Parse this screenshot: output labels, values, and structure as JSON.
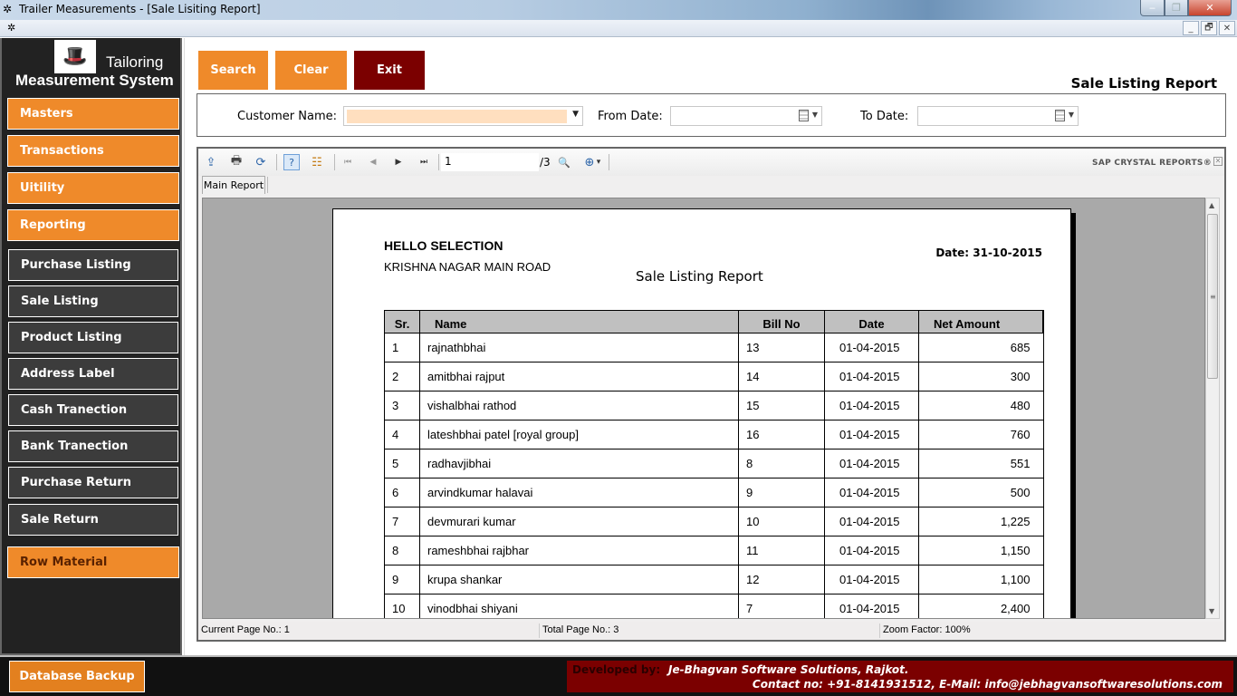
{
  "window": {
    "title": "Trailer Measurements - [Sale Lisiting Report]",
    "app_icon": "✲",
    "min": "‒",
    "max": "❐",
    "close": "✕"
  },
  "mdi": {
    "min": "_",
    "restore": "🗗",
    "close": "✕"
  },
  "sidebar": {
    "logo_line1": "Tailoring",
    "logo_line2": "Measurement System",
    "logo_icon": "🎩",
    "items": [
      {
        "label": "Masters",
        "style": "orange"
      },
      {
        "label": "Transactions",
        "style": "orange"
      },
      {
        "label": "Uitility",
        "style": "orange"
      },
      {
        "label": "Reporting",
        "style": "orange"
      },
      {
        "label": "Purchase Listing",
        "style": "dark"
      },
      {
        "label": "Sale Listing",
        "style": "dark"
      },
      {
        "label": "Product Listing",
        "style": "dark"
      },
      {
        "label": "Address Label",
        "style": "dark"
      },
      {
        "label": "Cash Tranection",
        "style": "dark"
      },
      {
        "label": "Bank Tranection",
        "style": "dark"
      },
      {
        "label": "Purchase Return",
        "style": "dark"
      },
      {
        "label": "Sale Return",
        "style": "dark"
      },
      {
        "label": "Row Material",
        "style": "orange"
      }
    ]
  },
  "toolbar": {
    "search": "Search",
    "clear": "Clear",
    "exit": "Exit"
  },
  "page_heading": "Sale Listing Report",
  "filters": {
    "customer_label": "Customer Name:",
    "customer_value": "",
    "from_label": "From Date:",
    "from_value": "",
    "to_label": "To Date:",
    "to_value": ""
  },
  "viewer": {
    "icons": {
      "export": "⇪",
      "print": "🖶",
      "refresh": "⟳",
      "help": "?",
      "tree": "☷",
      "first": "⏮",
      "prev": "◀",
      "next": "▶",
      "last": "⏭",
      "find": "🔍",
      "zoom": "⊕",
      "zoom_dd": "▾"
    },
    "current_page": "1",
    "total_pages_label": "/3",
    "brand": "SAP CRYSTAL REPORTS®",
    "tab": "Main Report",
    "status": {
      "current": "Current Page No.: 1",
      "total": "Total Page No.: 3",
      "zoom": "Zoom Factor: 100%"
    }
  },
  "report": {
    "company": "HELLO SELECTION",
    "address": "KRISHNA NAGAR MAIN ROAD",
    "title": "Sale Listing Report",
    "date": "Date:  31-10-2015",
    "columns": [
      "Sr.",
      "Name",
      "Bill No",
      "Date",
      "Net Amount"
    ],
    "rows": [
      [
        "1",
        "rajnathbhai",
        "13",
        "01-04-2015",
        "685"
      ],
      [
        "2",
        "amitbhai rajput",
        "14",
        "01-04-2015",
        "300"
      ],
      [
        "3",
        "vishalbhai rathod",
        "15",
        "01-04-2015",
        "480"
      ],
      [
        "4",
        "lateshbhai patel [royal group]",
        "16",
        "01-04-2015",
        "760"
      ],
      [
        "5",
        "radhavjibhai",
        "8",
        "01-04-2015",
        "551"
      ],
      [
        "6",
        "arvindkumar halavai",
        "9",
        "01-04-2015",
        "500"
      ],
      [
        "7",
        "devmurari kumar",
        "10",
        "01-04-2015",
        "1,225"
      ],
      [
        "8",
        "rameshbhai rajbhar",
        "11",
        "01-04-2015",
        "1,150"
      ],
      [
        "9",
        "krupa shankar",
        "12",
        "01-04-2015",
        "1,100"
      ],
      [
        "10",
        "vinodbhai shiyani",
        "7",
        "01-04-2015",
        "2,400"
      ]
    ]
  },
  "footer": {
    "backup": "Database Backup",
    "dev_label": "Developed by:",
    "dev_company": "Je-Bhagvan Software Solutions, Rajkot.",
    "dev_contact": "Contact no: +91-8141931512, E-Mail: info@jebhagvansoftwaresolutions.com"
  }
}
